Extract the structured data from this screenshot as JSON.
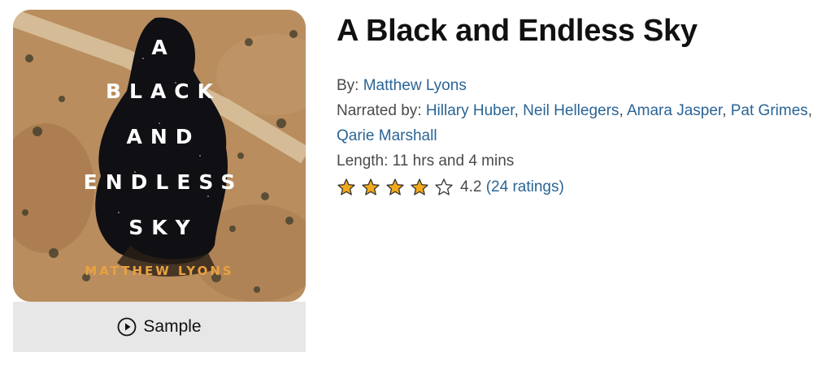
{
  "cover": {
    "title_lines": [
      "A",
      "BLACK",
      "AND",
      "ENDLESS",
      "SKY"
    ],
    "author": "MATTHEW LYONS",
    "colors": {
      "sand": "#b58a5c",
      "dark": "#0f0f14",
      "author": "#e9a23e"
    }
  },
  "sample_button": {
    "label": "Sample",
    "icon": "play-circle-icon"
  },
  "book": {
    "title": "A Black and Endless Sky",
    "by_label": "By: ",
    "author": "Matthew Lyons",
    "narrated_label": "Narrated by: ",
    "narrators": [
      "Hillary Huber",
      "Neil Hellegers",
      "Amara Jasper",
      "Pat Grimes",
      "Qarie Marshall"
    ],
    "separator": ", ",
    "length_label": "Length: ",
    "length": "11 hrs and 4 mins",
    "rating": {
      "value": "4.2",
      "stars_filled": 4,
      "stars_total": 5,
      "count_text": "(24 ratings)"
    }
  },
  "colors": {
    "link": "#2a6496",
    "star_fill": "#f3a81b",
    "star_outline": "#333333"
  }
}
